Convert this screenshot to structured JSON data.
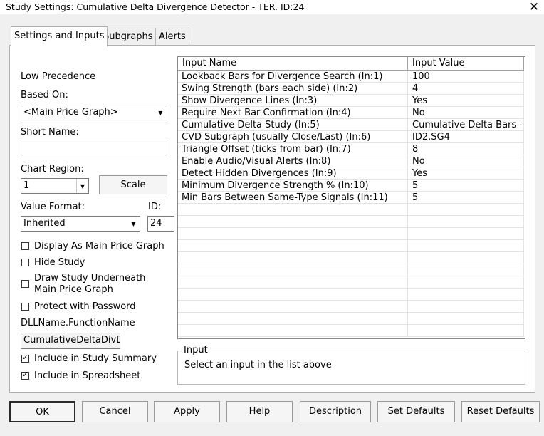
{
  "window": {
    "title": "Study Settings: Cumulative Delta Divergence Detector - TER. ID:24",
    "close_glyph": "✕"
  },
  "tabs": [
    {
      "label": "Settings and Inputs",
      "active": true
    },
    {
      "label": "Subgraphs",
      "active": false
    },
    {
      "label": "Alerts",
      "active": false
    }
  ],
  "left": {
    "precedence": "Low Precedence",
    "based_on_label": "Based On:",
    "based_on_value": "<Main Price Graph>",
    "short_name_label": "Short Name:",
    "short_name_value": "",
    "chart_region_label": "Chart Region:",
    "chart_region_value": "1",
    "scale_button": "Scale",
    "value_format_label": "Value Format:",
    "value_format_value": "Inherited",
    "id_label": "ID:",
    "id_value": "24",
    "checkboxes": [
      {
        "label": "Display As Main Price Graph",
        "checked": false
      },
      {
        "label": "Hide Study",
        "checked": false
      },
      {
        "label": "Draw Study Underneath",
        "label2": "Main Price Graph",
        "checked": false
      },
      {
        "label": "Protect with Password",
        "checked": false
      }
    ],
    "dll_label": "DLLName.FunctionName",
    "dll_value": "CumulativeDeltaDivDe",
    "summary_checkboxes": [
      {
        "label": "Include in Study Summary",
        "checked": true
      },
      {
        "label": "Include in Spreadsheet",
        "checked": true
      }
    ]
  },
  "grid": {
    "headers": [
      "Input Name",
      "Input Value"
    ],
    "rows": [
      {
        "name": "Lookback Bars for Divergence Search  (In:1)",
        "value": "100"
      },
      {
        "name": "Swing Strength (bars each side)  (In:2)",
        "value": "4"
      },
      {
        "name": "Show Divergence Lines  (In:3)",
        "value": "Yes"
      },
      {
        "name": "Require Next Bar Confirmation  (In:4)",
        "value": "No"
      },
      {
        "name": "Cumulative Delta Study  (In:5)",
        "value": "Cumulative Delta Bars -..."
      },
      {
        "name": "CVD Subgraph (usually Close/Last)  (In:6)",
        "value": "ID2.SG4"
      },
      {
        "name": "Triangle Offset (ticks from bar)  (In:7)",
        "value": "8"
      },
      {
        "name": "Enable Audio/Visual Alerts  (In:8)",
        "value": "No"
      },
      {
        "name": "Detect Hidden Divergences  (In:9)",
        "value": "Yes"
      },
      {
        "name": "Minimum Divergence Strength %  (In:10)",
        "value": "5"
      },
      {
        "name": "Min Bars Between Same-Type Signals  (In:11)",
        "value": "5"
      }
    ]
  },
  "input_group": {
    "title": "Input",
    "hint": "Select an input in the list above"
  },
  "buttons": [
    "OK",
    "Cancel",
    "Apply",
    "Help",
    "Description",
    "Set Defaults",
    "Reset Defaults"
  ],
  "icons": {
    "dropdown": "chevron-down-icon",
    "check": "checkmark-icon",
    "close": "close-icon"
  }
}
